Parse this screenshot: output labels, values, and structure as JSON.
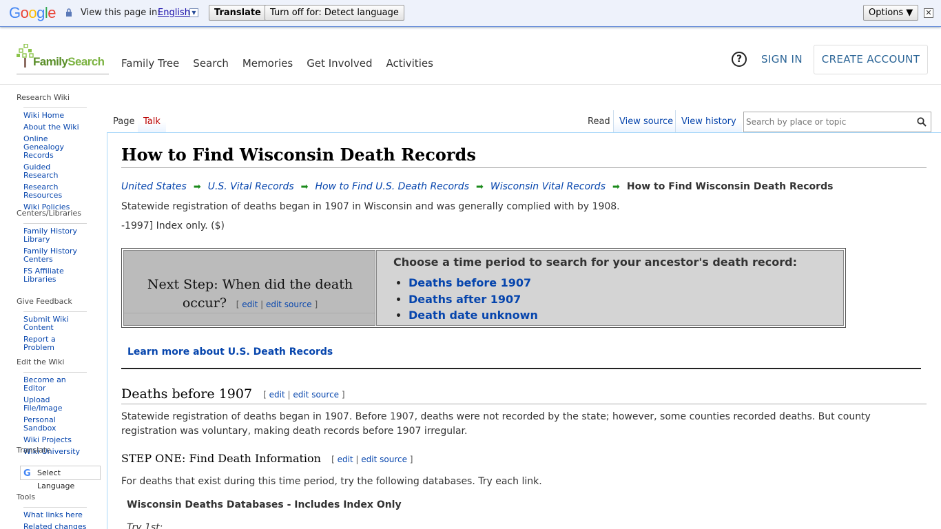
{
  "translate_bar": {
    "logo": "Google",
    "view_label": "View this page in:",
    "language": "English",
    "translate_button": "Translate",
    "turn_off_button": "Turn off for: Detect language",
    "options_button": "Options ▼",
    "close": "✕"
  },
  "header": {
    "logo_prefix": "Family",
    "logo_suffix": "Search",
    "nav": [
      "Family Tree",
      "Search",
      "Memories",
      "Get Involved",
      "Activities"
    ],
    "help": "?",
    "sign_in": "SIGN IN",
    "create_account": "CREATE ACCOUNT"
  },
  "sidebar": {
    "research_wiki": {
      "heading": "Research Wiki",
      "items": [
        "Wiki Home",
        "About the Wiki",
        "Online Genealogy Records",
        "Guided Research",
        "Research Resources",
        "Wiki Policies"
      ]
    },
    "centers": {
      "heading": "Centers/Libraries",
      "items": [
        "Family History Library",
        "Family History Centers",
        "FS Affiliate Libraries"
      ]
    },
    "feedback": {
      "heading": "Give Feedback",
      "items": [
        "Submit Wiki Content",
        "Report a Problem"
      ]
    },
    "edit": {
      "heading": "Edit the Wiki",
      "items": [
        "Become an Editor",
        "Upload File/Image",
        "Personal Sandbox",
        "Wiki Projects",
        "Wiki University"
      ]
    },
    "translate": {
      "heading": "Translate",
      "select_language": "Select Language"
    },
    "tools": {
      "heading": "Tools",
      "items": [
        "What links here",
        "Related changes"
      ]
    }
  },
  "tabs": {
    "page": "Page",
    "talk": "Talk",
    "read": "Read",
    "view_source": "View source",
    "view_history": "View history"
  },
  "search": {
    "placeholder": "Search by place or topic"
  },
  "article": {
    "title": "How to Find Wisconsin Death Records",
    "breadcrumb": [
      "United States",
      "U.S. Vital Records",
      "How to Find U.S. Death Records",
      "Wisconsin Vital Records"
    ],
    "breadcrumb_current": "How to Find Wisconsin Death Records",
    "intro": "Statewide registration of deaths began in 1907 in Wisconsin and was generally complied with by 1908.",
    "index_note": "-1997] Index only. ($)",
    "next_step": {
      "question": "Next Step: When did the death occur?",
      "question_line1": "Next Step: When did the death",
      "question_line2": "occur?",
      "prompt": "Choose a time period to search for your ancestor's death record:",
      "options": [
        "Deaths before 1907",
        "Deaths after 1907",
        "Death date unknown"
      ]
    },
    "edit": "edit",
    "edit_source": "edit source",
    "learn_more": "Learn more about U.S. Death Records",
    "section1_title": "Deaths before 1907",
    "section1_text": "Statewide registration of deaths began in 1907. Before 1907, deaths were not recorded by the state; however, some counties recorded deaths. But county registration was voluntary, making death records before 1907 irregular.",
    "step_one_title": "STEP ONE: Find Death Information",
    "step_one_text": "For deaths that exist during this time period, try the following databases. Try each link.",
    "db_title": "Wisconsin Deaths Databases - Includes Index Only",
    "try_first": "Try 1st:"
  }
}
